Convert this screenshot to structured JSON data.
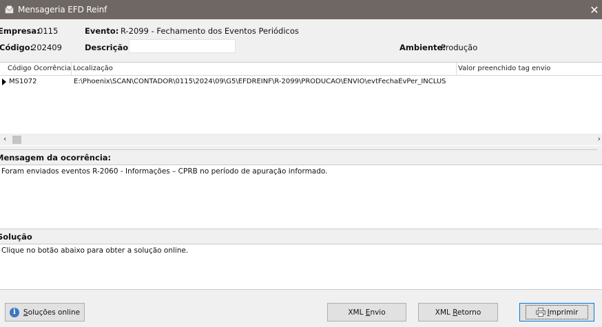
{
  "window": {
    "title": "Mensageria EFD Reinf",
    "close_glyph": "✕"
  },
  "header": {
    "empresa_label": "Empresa:",
    "empresa_value": "0115",
    "codigo_label": "Código:",
    "codigo_value": "202409",
    "evento_label": "Evento:",
    "evento_value": "R-2099 - Fechamento dos Eventos Periódicos",
    "descricao_label": "Descrição:",
    "descricao_value": "",
    "ambiente_label": "Ambiente:",
    "ambiente_value": "Produção"
  },
  "grid": {
    "columns": [
      "Código Ocorrência",
      "Localização",
      "Valor preenchido tag envio"
    ],
    "rows": [
      {
        "codigo": "MS1072",
        "localizacao": "E:\\Phoenix\\SCAN\\CONTADOR\\0115\\2024\\09\\G5\\EFDREINF\\R-2099\\PRODUCAO\\ENVIO\\evtFechaEvPer_INCLUS",
        "valor": ""
      }
    ]
  },
  "mensagem": {
    "label": "Mensagem da ocorrência:",
    "text": "Foram enviados eventos R-2060 - Informações – CPRB no período de apuração informado."
  },
  "solucao": {
    "label": "Solução",
    "text": "Clique no botão abaixo para obter a solução online."
  },
  "buttons": {
    "solucoes_prefix": "S",
    "solucoes_rest": "oluções online",
    "xml_envio_prefix": "XML ",
    "xml_envio_u": "E",
    "xml_envio_rest": "nvio",
    "xml_retorno_prefix": "XML ",
    "xml_retorno_u": "R",
    "xml_retorno_rest": "etorno",
    "imprimir_u": "I",
    "imprimir_rest": "mprimir"
  },
  "icons": {
    "app": "envelope-icon",
    "info": "info-icon",
    "printer": "printer-icon"
  }
}
